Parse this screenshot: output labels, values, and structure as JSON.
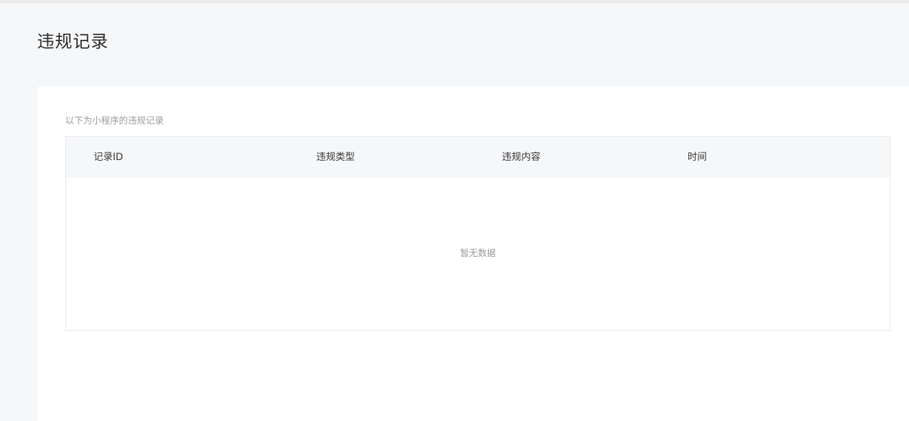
{
  "page": {
    "title": "违规记录"
  },
  "panel": {
    "description": "以下为小程序的违规记录"
  },
  "table": {
    "columns": [
      "记录ID",
      "违规类型",
      "违规内容",
      "时间"
    ],
    "rows": [],
    "empty_text": "暂无数据"
  }
}
